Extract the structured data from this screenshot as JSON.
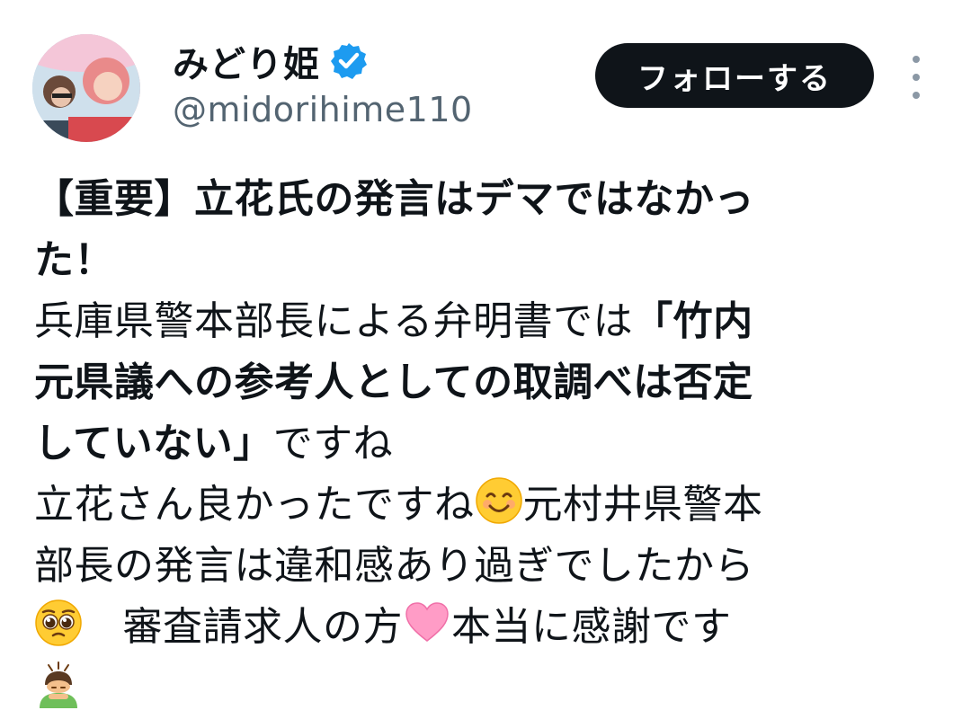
{
  "author": {
    "display_name": "みどり姫",
    "handle": "@midorihime110",
    "verified_icon": "verified-badge-icon",
    "accent_color": "#1d9bf0"
  },
  "actions": {
    "follow_label": "フォローする",
    "more_icon": "more-options-icon"
  },
  "tweet": {
    "line1": "【重要】立花氏の発言はデマではなかっ",
    "line2": "た！",
    "line3_normal": "兵庫県警本部長による弁明書では",
    "line3_bold": "「竹内",
    "line4": "元県議への参考人としての取調べは否定",
    "line5_bold": "していない」",
    "line5_normal": "ですね",
    "line6_a": "立花さん良かったですね",
    "line6_emoji": "smiling-face-emoji",
    "line6_b": "元村井県警本",
    "line7": "部長の発言は違和感あり過ぎでしたから",
    "line8_emoji1": "pleading-face-emoji",
    "line8_a": "　審査請求人の方",
    "line8_emoji2": "pink-heart-emoji",
    "line8_b": "本当に感謝です",
    "line9_emoji": "person-bowing-emoji"
  }
}
